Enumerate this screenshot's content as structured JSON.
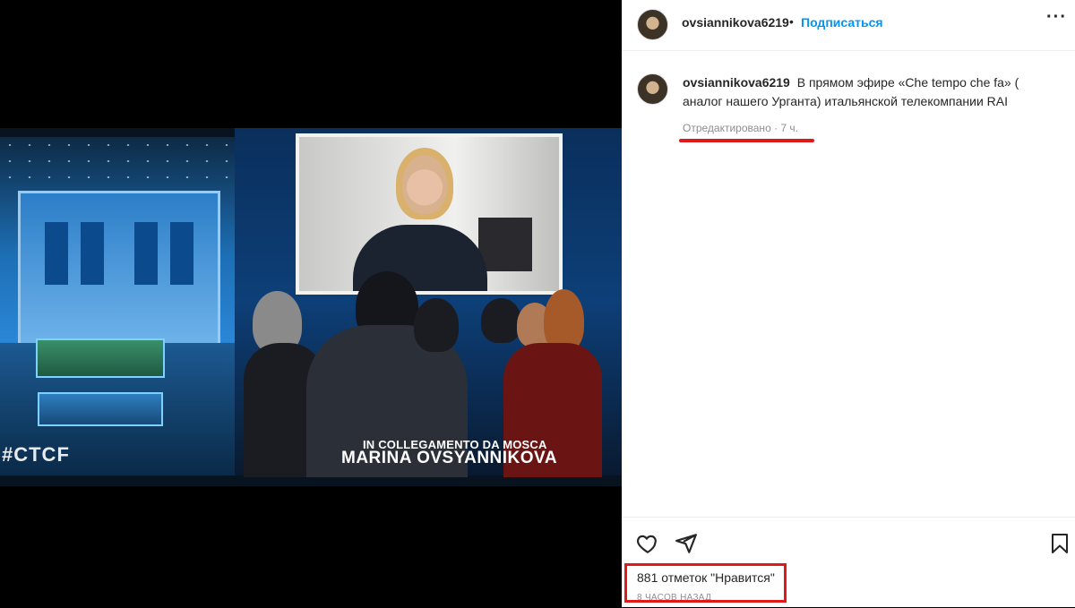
{
  "post": {
    "username": "ovsiannikova6219",
    "separator": "•",
    "follow_label": "Подписаться",
    "more_label": "···"
  },
  "media": {
    "hashtag": "#CTCF",
    "caption_line1": "IN COLLEGAMENTO DA MOSCA",
    "caption_line2": "MARINA OVSYANNIKOVA"
  },
  "comment": {
    "username": "ovsiannikova6219",
    "text": "В прямом эфире «Che tempo che fa» ( аналог нашего Урганта) итальянской телекомпании RAI",
    "meta": "Отредактировано · 7 ч."
  },
  "actions": {
    "likes": "881 отметок \"Нравится\"",
    "posted": "8 ЧАСОВ НАЗАД"
  },
  "colors": {
    "accent": "#0095f6",
    "annotation": "#e01919"
  },
  "icons": [
    "heart-icon",
    "share-icon",
    "bookmark-icon",
    "more-icon"
  ]
}
